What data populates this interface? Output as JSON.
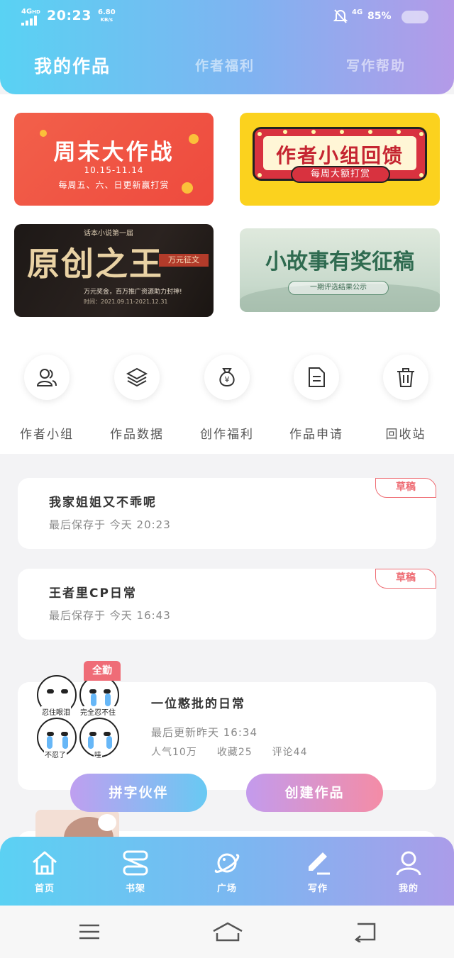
{
  "status_bar": {
    "network": "4G",
    "network_suffix": "HD",
    "time": "20:23",
    "speed_value": "6.80",
    "speed_unit": "KB/s",
    "cell_4g": "4G",
    "battery": "85%"
  },
  "tabs": [
    {
      "label": "我的作品",
      "active": true
    },
    {
      "label": "作者福利",
      "active": false
    },
    {
      "label": "写作帮助",
      "active": false
    }
  ],
  "banners": [
    {
      "title": "周末大作战",
      "dates": "10.15-11.14",
      "desc": "每周五、六、日更新赢打赏"
    },
    {
      "title": "作者小组回馈",
      "tag": "每周大额打赏"
    },
    {
      "small": "话本小说第一届",
      "title": "原创之王",
      "badge": "万元征文",
      "desc": "万元奖金，百万推广资源助力封神!",
      "period": "时间：2021.09.11-2021.12.31"
    },
    {
      "title": "小故事有奖征稿",
      "pill": "一期评选结果公示"
    }
  ],
  "quick_icons": [
    {
      "label": "作者小组",
      "icon": "users-icon"
    },
    {
      "label": "作品数据",
      "icon": "layers-icon"
    },
    {
      "label": "创作福利",
      "icon": "money-bag-icon"
    },
    {
      "label": "作品申请",
      "icon": "document-icon"
    },
    {
      "label": "回收站",
      "icon": "trash-icon"
    }
  ],
  "works": [
    {
      "title": "我家姐姐又不乖呢",
      "subtitle": "最后保存于 今天 20:23",
      "badge": "草稿"
    },
    {
      "title": "王者里CP日常",
      "subtitle": "最后保存于 今天 16:43",
      "badge": "草稿"
    },
    {
      "title": "一位憨批的日常",
      "subtitle": "最后更新昨天 16:34",
      "badge": "全勤",
      "cover_captions": [
        "忍住眼泪",
        "完全忍不住",
        "不忍了",
        "哇"
      ],
      "stats": {
        "popularity": "人气10万",
        "favorites": "收藏25",
        "comments": "评论44"
      }
    }
  ],
  "fabs": {
    "partner": "拼字伙伴",
    "create": "创建作品"
  },
  "bottom_nav": [
    {
      "label": "首页",
      "icon": "home-icon"
    },
    {
      "label": "书架",
      "icon": "bookshelf-icon"
    },
    {
      "label": "广场",
      "icon": "planet-icon"
    },
    {
      "label": "写作",
      "icon": "pen-icon"
    },
    {
      "label": "我的",
      "icon": "profile-icon"
    }
  ],
  "colors": {
    "header_gradient_start": "#59d2f3",
    "header_gradient_end": "#b49ae8",
    "draft_red": "#ee6c73",
    "fab_left_start": "#bf9ff0",
    "fab_right_end": "#f48ca6"
  }
}
